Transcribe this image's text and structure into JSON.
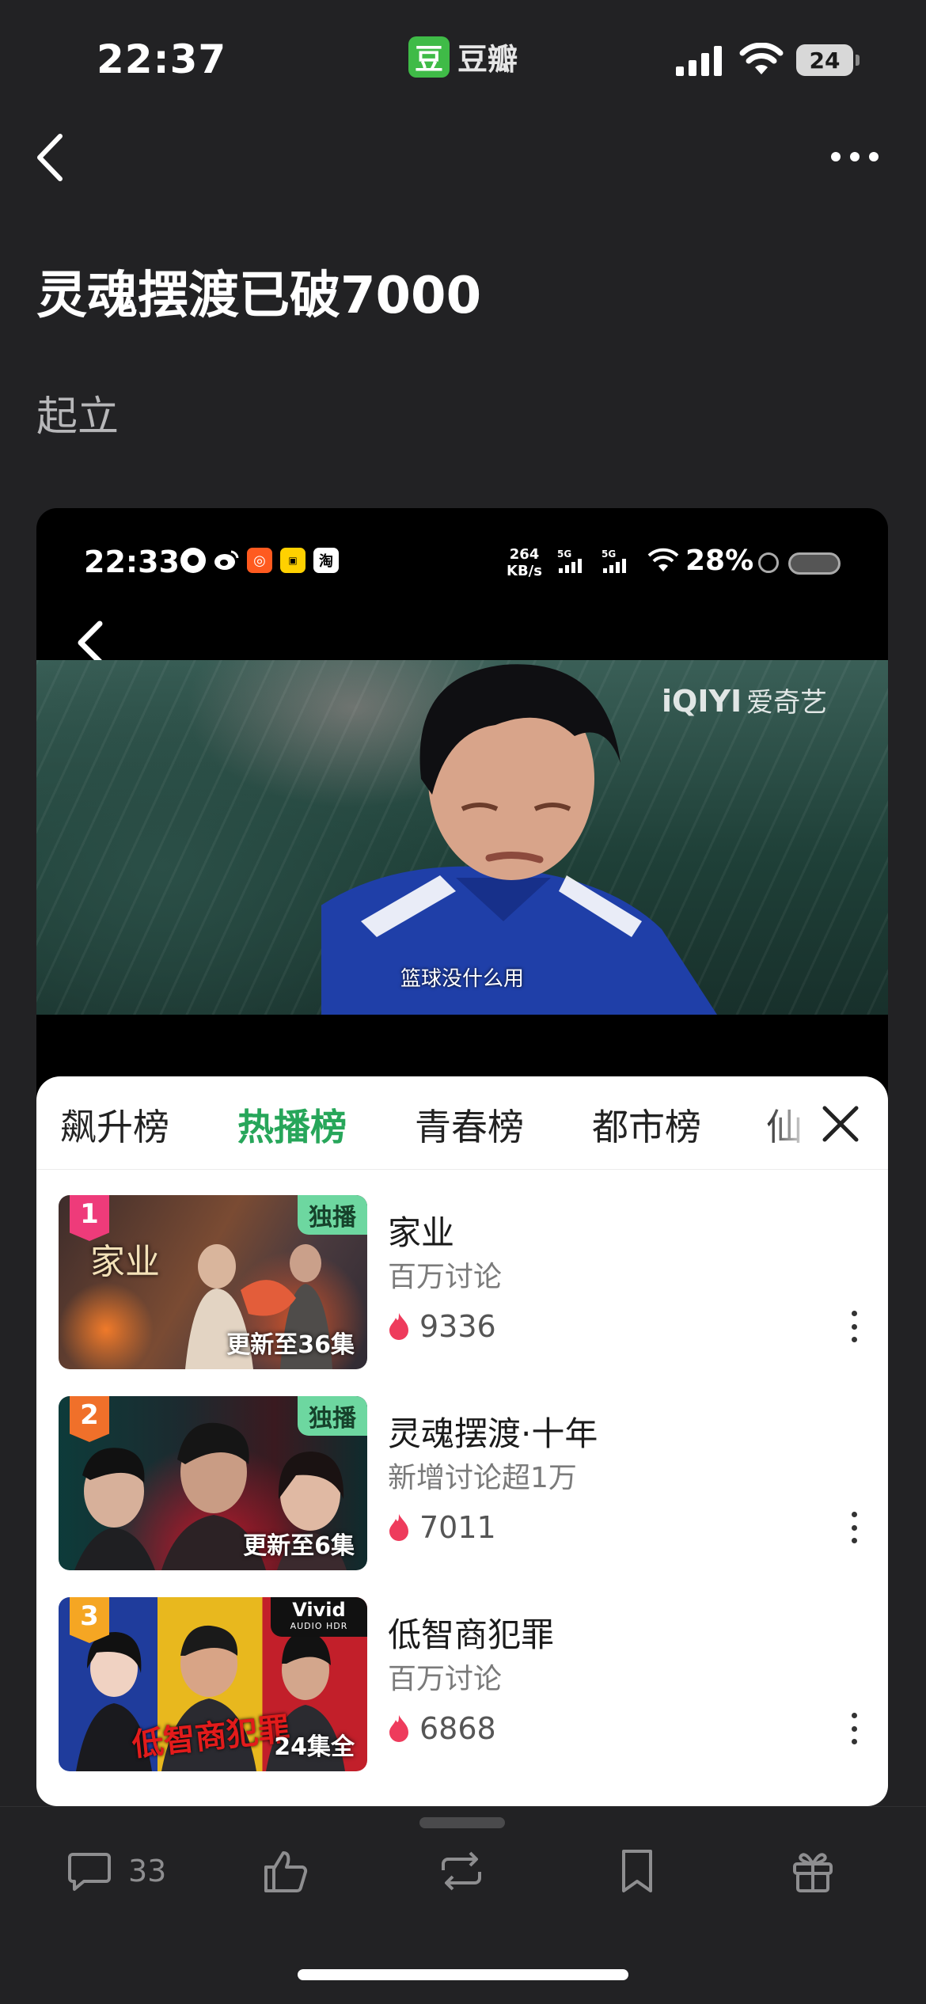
{
  "status_bar": {
    "time": "22:37",
    "app_logo": "豆",
    "app_name": "豆瓣",
    "battery": "24"
  },
  "post": {
    "title": "灵魂摆渡已破7000",
    "body": "起立"
  },
  "embedded": {
    "status": {
      "time": "22:33",
      "speed_value": "264",
      "speed_unit": "KB/s",
      "sim1": "5G",
      "sim2": "5G",
      "battery": "28%"
    },
    "video": {
      "watermark": "iQIYI",
      "watermark_cn": "爱奇艺",
      "subtitle": "篮球没什么用"
    },
    "tabs": [
      "飙升榜",
      "热播榜",
      "青春榜",
      "都市榜",
      "仙"
    ],
    "active_tab": 1,
    "shows": [
      {
        "rank": "1",
        "rank_color": "#ee3b7a",
        "tag": "独播",
        "episodes": "更新至36集",
        "thumb_title": "家业",
        "name": "家业",
        "sub": "百万讨论",
        "heat": "9336"
      },
      {
        "rank": "2",
        "rank_color": "#f0702a",
        "tag": "独播",
        "episodes": "更新至6集",
        "name": "灵魂摆渡·十年",
        "sub": "新增讨论超1万",
        "heat": "7011"
      },
      {
        "rank": "3",
        "rank_color": "#f5a623",
        "badge": "Vivid",
        "badge_sub": "AUDIO HDR",
        "episodes": "24集全",
        "thumb_title": "低智商犯罪",
        "name": "低智商犯罪",
        "sub": "百万讨论",
        "heat": "6868"
      }
    ]
  },
  "actions": {
    "comments": "33"
  },
  "colors": {
    "background": "#222224",
    "accent_green": "#27a65a",
    "heat_pink": "#ee3b5c"
  }
}
